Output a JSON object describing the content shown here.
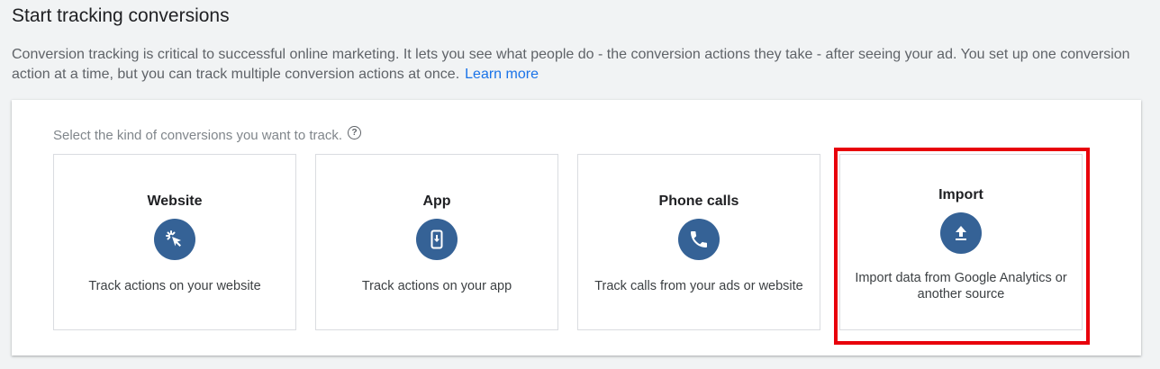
{
  "page": {
    "title": "Start tracking conversions",
    "intro": "Conversion tracking is critical to successful online marketing. It lets you see what people do - the conversion actions they take - after seeing your ad. You set up one conversion action at a time, but you can track multiple conversion actions at once.",
    "learn_more": "Learn more"
  },
  "selector": {
    "prompt": "Select the kind of conversions you want to track.",
    "help_icon": "?",
    "cards": [
      {
        "title": "Website",
        "icon": "cursor-click-icon",
        "description": "Track actions on your website"
      },
      {
        "title": "App",
        "icon": "phone-download-icon",
        "description": "Track actions on your app"
      },
      {
        "title": "Phone calls",
        "icon": "phone-icon",
        "description": "Track calls from your ads or website"
      },
      {
        "title": "Import",
        "icon": "upload-icon",
        "description": "Import data from Google Analytics or another source",
        "highlighted": true
      }
    ]
  },
  "colors": {
    "icon_circle": "#356296",
    "link": "#1a73e8",
    "highlight": "#e8000b"
  }
}
